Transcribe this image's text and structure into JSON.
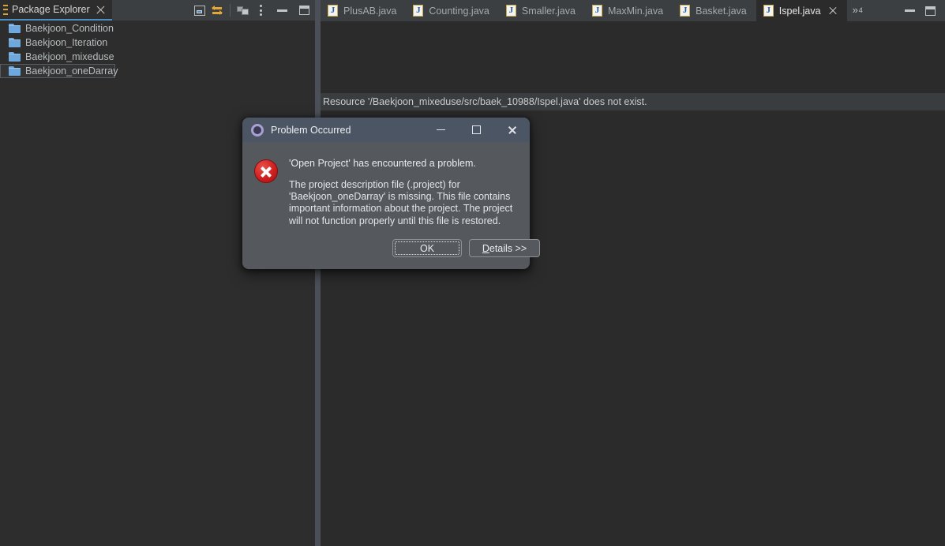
{
  "view": {
    "tab": {
      "label": "Package Explorer",
      "grip_icon": "grip-dots-icon",
      "close_icon": "close-icon"
    },
    "toolbar": [
      {
        "name": "collapse-all-button",
        "icon": "collapse-all-icon"
      },
      {
        "name": "link-with-editor-button",
        "icon": "link-with-editor-icon"
      },
      {
        "name": "view-menu-button",
        "icon": "package-presentation-icon"
      },
      {
        "name": "view-more-button",
        "icon": "vertical-ellipsis-icon"
      },
      {
        "name": "minimize-view-button",
        "icon": "minimize-icon"
      },
      {
        "name": "maximize-view-button",
        "icon": "maximize-icon"
      }
    ],
    "tree": [
      {
        "label": "Baekjoon_Condition",
        "icon": "folder-icon",
        "selected": false
      },
      {
        "label": "Baekjoon_Iteration",
        "icon": "folder-icon",
        "selected": false
      },
      {
        "label": "Baekjoon_mixeduse",
        "icon": "folder-icon",
        "selected": false
      },
      {
        "label": "Baekjoon_oneDarray",
        "icon": "folder-icon",
        "selected": true
      }
    ]
  },
  "editor": {
    "tabs": [
      {
        "label": "PlusAB.java",
        "icon": "java-file-icon",
        "active": false
      },
      {
        "label": "Counting.java",
        "icon": "java-file-icon",
        "active": false
      },
      {
        "label": "Smaller.java",
        "icon": "java-file-icon",
        "active": false
      },
      {
        "label": "MaxMin.java",
        "icon": "java-file-icon",
        "active": false
      },
      {
        "label": "Basket.java",
        "icon": "java-file-icon",
        "active": false
      },
      {
        "label": "Ispel.java",
        "icon": "java-file-icon",
        "active": true
      }
    ],
    "overflow": {
      "chevrons": "»",
      "count": "4",
      "icon": "chevron-double-right-icon"
    },
    "window_controls": [
      {
        "name": "restore-editor-button",
        "icon": "minimize-icon"
      },
      {
        "name": "maximize-editor-button",
        "icon": "maximize-icon"
      }
    ],
    "resource_message": "Resource '/Baekjoon_mixeduse/src/baek_10988/Ispel.java' does not exist."
  },
  "dialog": {
    "title": "Problem Occurred",
    "title_icon": "eclipse-gear-icon",
    "error_icon": "error-circle-icon",
    "heading": "'Open Project' has encountered a problem.",
    "message": "The project description file (.project) for\n'Baekjoon_oneDarray' is missing.  This file contains\nimportant information about the project.  The project\nwill not function properly until this file is restored.",
    "buttons": {
      "ok": "OK",
      "details_mnemonic": "D",
      "details_rest": "etails >>"
    },
    "window_controls": [
      {
        "name": "dialog-minimize-button",
        "icon": "minimize-icon"
      },
      {
        "name": "dialog-maximize-button",
        "icon": "maximize-icon"
      },
      {
        "name": "dialog-close-button",
        "icon": "close-icon"
      }
    ]
  },
  "colors": {
    "workbench_bg": "#2b2b2b",
    "panel_bg": "#2d2d2d",
    "tabbar_bg": "#3c3f41",
    "accent_tab_underline": "#4a90c4",
    "sash": "#4b5058",
    "dialog_body": "#55595d",
    "dialog_titlebar": "#4b5564",
    "error_red": "#cf1f1f",
    "folder_blue": "#6fa8dc",
    "link_yellow": "#e3a834"
  }
}
